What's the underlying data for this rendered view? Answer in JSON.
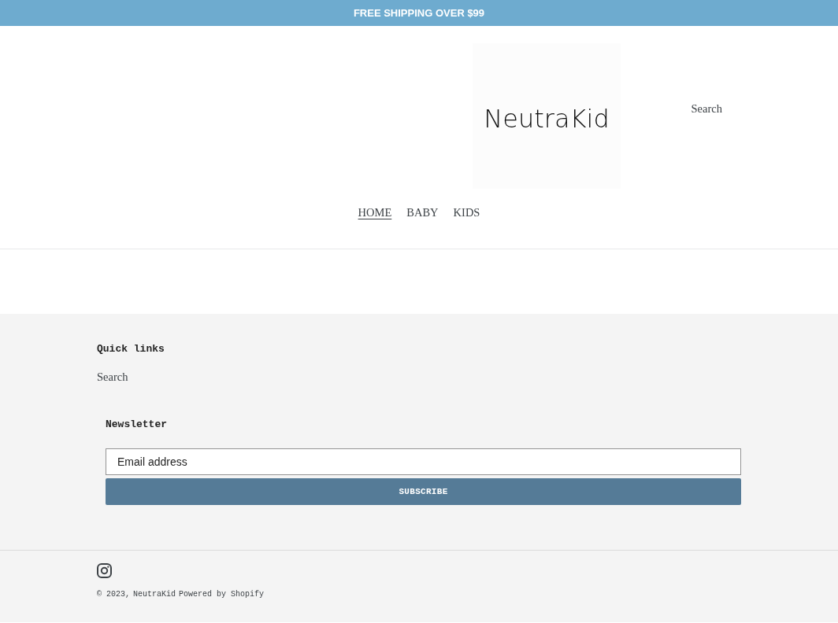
{
  "announcement_bar": {
    "text": "FREE SHIPPING OVER $99"
  },
  "header": {
    "logo": {
      "text": "NeutraKid"
    },
    "search_link": "Search",
    "nav": [
      {
        "label": "HOME",
        "selected": true
      },
      {
        "label": "BABY",
        "selected": false
      },
      {
        "label": "KIDS",
        "selected": false
      }
    ]
  },
  "footer": {
    "quick_links": {
      "heading": "Quick links",
      "links": [
        "Search"
      ]
    },
    "newsletter": {
      "heading": "Newsletter",
      "email_field": {
        "placeholder": "Email address"
      },
      "subscribe_button": "SUBSCRIBE"
    },
    "copyright": {
      "text": "© 2023,",
      "store_link": "NeutraKid",
      "powered_by_link": "Powered by Shopify"
    }
  }
}
